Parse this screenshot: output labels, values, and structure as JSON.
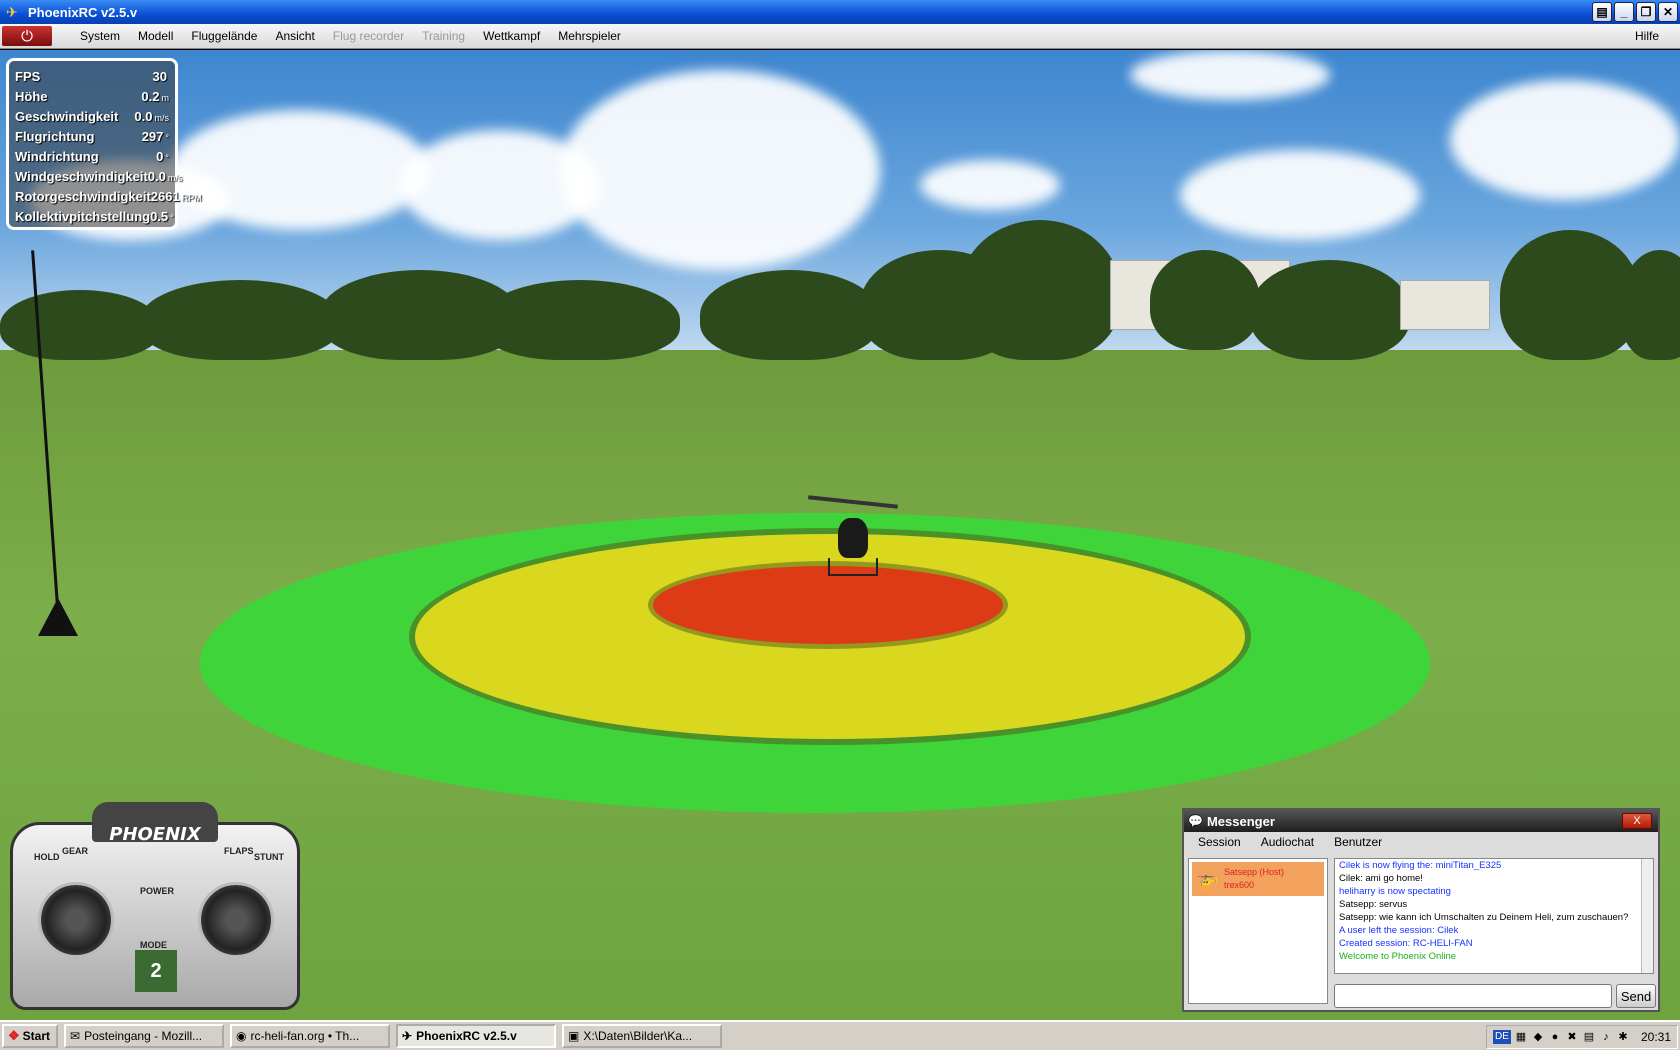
{
  "window": {
    "title": "PhoenixRC v2.5.v"
  },
  "menu": {
    "items": [
      {
        "label": "System",
        "enabled": true
      },
      {
        "label": "Modell",
        "enabled": true
      },
      {
        "label": "Fluggelände",
        "enabled": true
      },
      {
        "label": "Ansicht",
        "enabled": true
      },
      {
        "label": "Flug recorder",
        "enabled": false
      },
      {
        "label": "Training",
        "enabled": false
      },
      {
        "label": "Wettkampf",
        "enabled": true
      },
      {
        "label": "Mehrspieler",
        "enabled": true
      }
    ],
    "help": "Hilfe"
  },
  "telemetry": [
    {
      "label": "FPS",
      "value": "30",
      "unit": ""
    },
    {
      "label": "Höhe",
      "value": "0.2",
      "unit": "m"
    },
    {
      "label": "Geschwindigkeit",
      "value": "0.0",
      "unit": "m/s"
    },
    {
      "label": "Flugrichtung",
      "value": "297",
      "unit": "°"
    },
    {
      "label": "Windrichtung",
      "value": "0",
      "unit": "°"
    },
    {
      "label": "Windgeschwindigkeit",
      "value": "0.0",
      "unit": "m/s"
    },
    {
      "label": "Rotorgeschwindigkeit",
      "value": "2661",
      "unit": "RPM"
    },
    {
      "label": "Kollektivpitchstellung",
      "value": "0.5",
      "unit": "°"
    }
  ],
  "remote": {
    "brand": "PHOENIX",
    "labels": {
      "hold": "HOLD",
      "gear": "GEAR",
      "flaps": "FLAPS",
      "stunt": "STUNT",
      "power": "POWER",
      "mode": "MODE"
    },
    "mode_value": "2"
  },
  "messenger": {
    "title": "Messenger",
    "close": "X",
    "menu": [
      "Session",
      "Audiochat",
      "Benutzer"
    ],
    "user": {
      "name": "Satsepp (Host)",
      "model": "trex600"
    },
    "log": [
      {
        "text": "Cilek is now flying the: miniTitan_E325",
        "color": "blue"
      },
      {
        "text": "Cilek: ami go home!",
        "color": "black"
      },
      {
        "text": "heliharry is now spectating",
        "color": "blue"
      },
      {
        "text": "Satsepp: servus",
        "color": "black"
      },
      {
        "text": "Satsepp: wie kann ich Umschalten zu Deinem Heli, zum zuschauen?",
        "color": "black"
      },
      {
        "text": "A user left the session: Cilek",
        "color": "blue"
      },
      {
        "text": "Created session: RC-HELI-FAN",
        "color": "blue"
      },
      {
        "text": "Welcome to Phoenix Online",
        "color": "green"
      }
    ],
    "input_value": "",
    "send": "Send"
  },
  "taskbar": {
    "start": "Start",
    "tasks": [
      {
        "label": "Posteingang - Mozill...",
        "active": false
      },
      {
        "label": "rc-heli-fan.org • Th...",
        "active": false
      },
      {
        "label": "PhoenixRC v2.5.v",
        "active": true
      },
      {
        "label": "X:\\Daten\\Bilder\\Ka...",
        "active": false
      }
    ],
    "tray_lang": "DE",
    "clock": "20:31"
  },
  "colors": {
    "accent": "#0a4fd4",
    "target_outer": "#3fd43a",
    "target_mid": "#d9d81e",
    "target_inner": "#dd3a16"
  }
}
